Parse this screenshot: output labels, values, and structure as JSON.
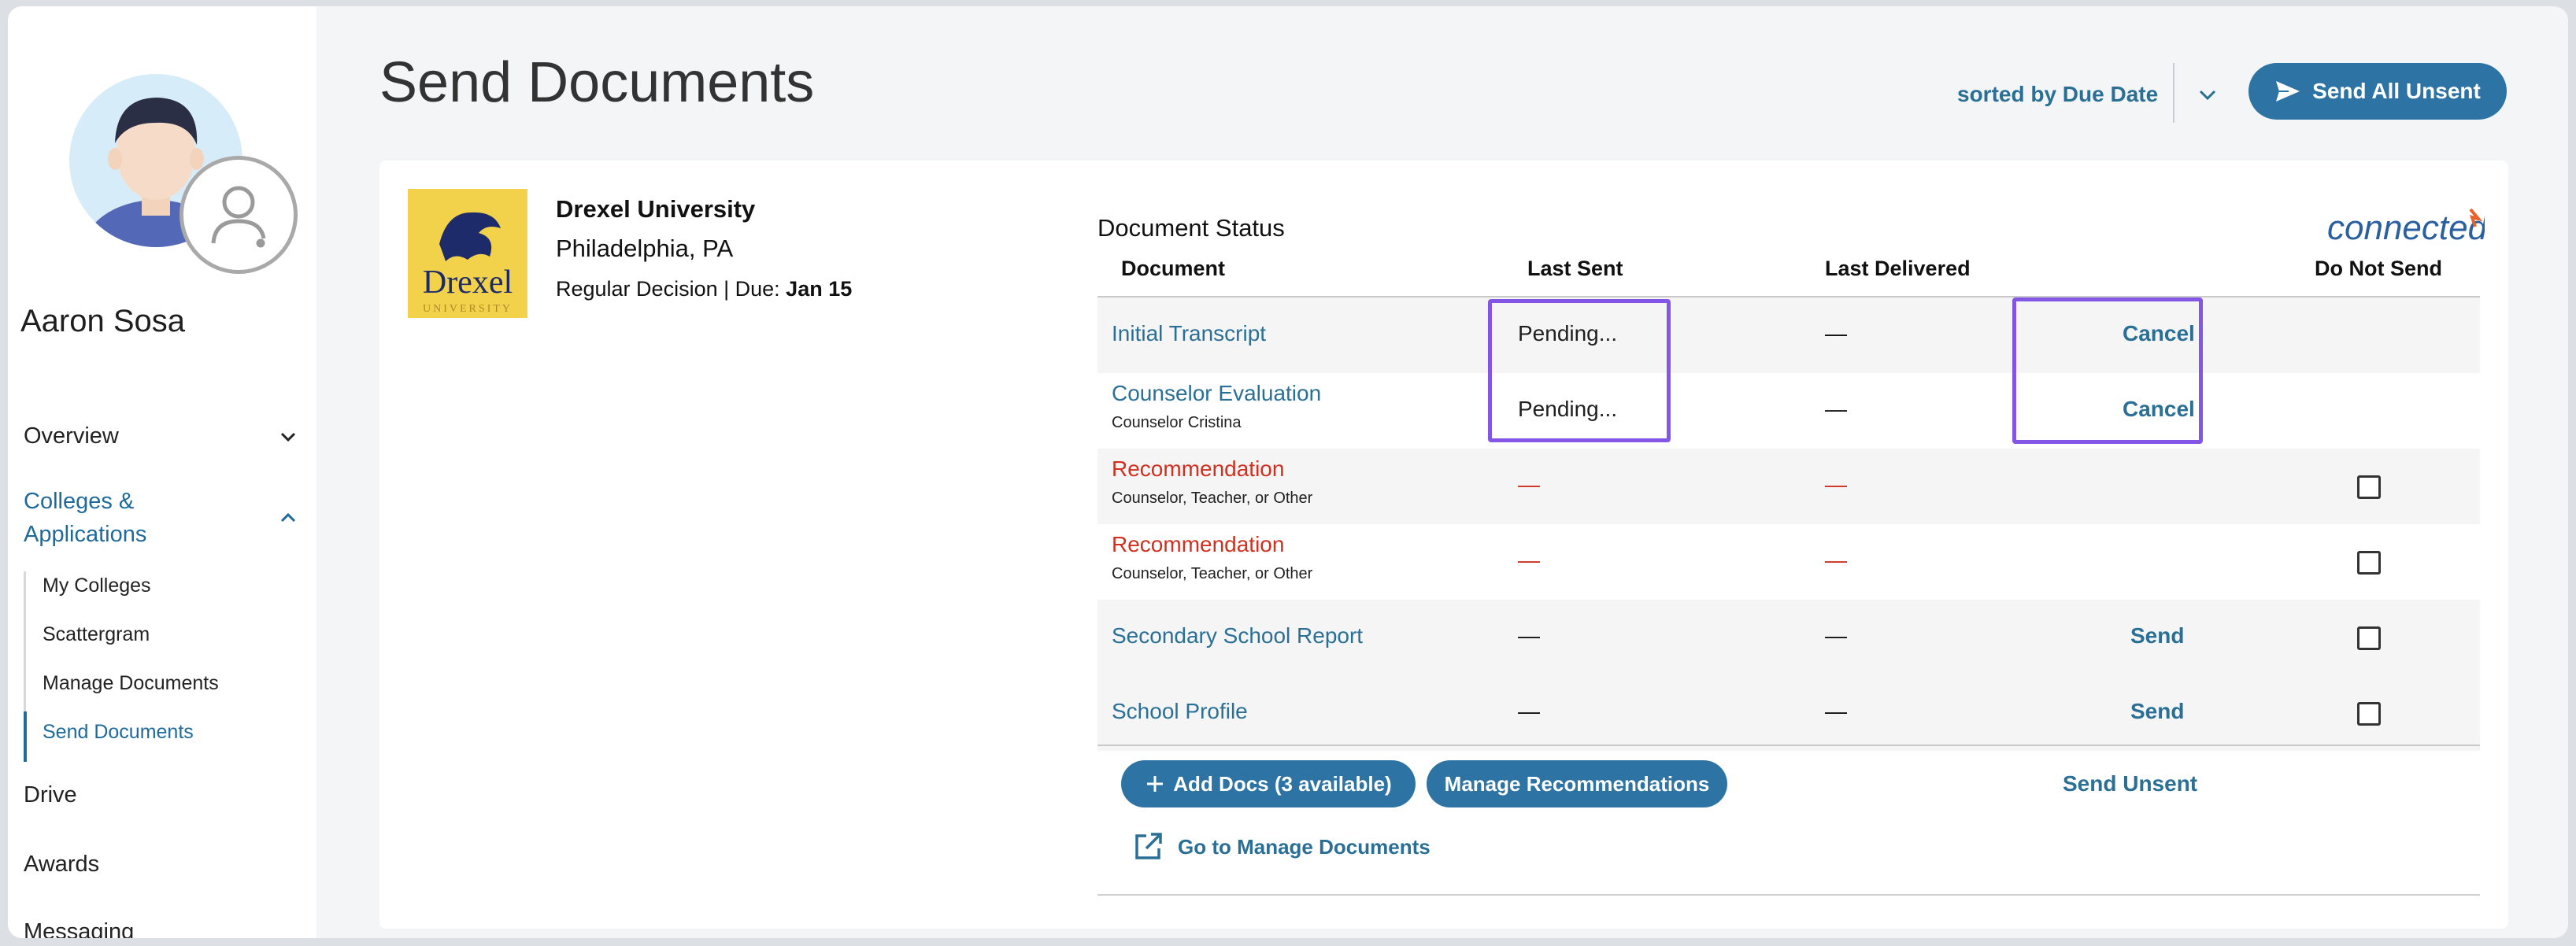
{
  "page": {
    "title": "Send Documents"
  },
  "user": {
    "name": "Aaron Sosa"
  },
  "sidebar": {
    "items": [
      {
        "label": "Overview",
        "expanded": false
      },
      {
        "label": "Colleges & Applications",
        "expanded": true
      },
      {
        "label": "Drive"
      },
      {
        "label": "Awards"
      },
      {
        "label": "Messaging"
      }
    ],
    "sub_items": [
      "My Colleges",
      "Scattergram",
      "Manage Documents",
      "Send Documents"
    ],
    "active_sub_item": "Send Documents"
  },
  "toolbar": {
    "sort_label": "sorted by Due Date",
    "send_all_label": "Send All Unsent"
  },
  "school": {
    "name": "Drexel University",
    "location": "Philadelphia, PA",
    "deadline_prefix": "Regular Decision | Due:",
    "deadline_date": "Jan 15",
    "logo_text": "Drexel",
    "logo_subtext": "UNIVERSITY"
  },
  "documents": {
    "title": "Document Status",
    "partner_logo": "connected",
    "columns": [
      "Document",
      "Last Sent",
      "Last Delivered",
      "Do Not Send"
    ],
    "rows": [
      {
        "name": "Initial Transcript",
        "sub": "",
        "last_sent": "Pending...",
        "last_delivered": "—",
        "action": "Cancel",
        "do_not_send": null,
        "status": "pending"
      },
      {
        "name": "Counselor Evaluation",
        "sub": "Counselor Cristina",
        "last_sent": "Pending...",
        "last_delivered": "—",
        "action": "Cancel",
        "do_not_send": null,
        "status": "pending"
      },
      {
        "name": "Recommendation",
        "sub": "Counselor, Teacher, or Other",
        "last_sent": "—",
        "last_delivered": "—",
        "action": "",
        "do_not_send": false,
        "status": "missing"
      },
      {
        "name": "Recommendation",
        "sub": "Counselor, Teacher, or Other",
        "last_sent": "—",
        "last_delivered": "—",
        "action": "",
        "do_not_send": false,
        "status": "missing"
      },
      {
        "name": "Secondary School Report",
        "sub": "",
        "last_sent": "—",
        "last_delivered": "—",
        "action": "Send",
        "do_not_send": false,
        "status": "ready"
      },
      {
        "name": "School Profile",
        "sub": "",
        "last_sent": "—",
        "last_delivered": "—",
        "action": "Send",
        "do_not_send": false,
        "status": "ready"
      }
    ],
    "add_docs_label": "Add Docs (3 available)",
    "manage_recs_label": "Manage Recommendations",
    "send_unsent_label": "Send Unsent",
    "manage_docs_link": "Go to Manage Documents"
  },
  "colors": {
    "accent": "#2d74a4",
    "link": "#2a6f96",
    "alert": "#d0301f",
    "highlight": "#8456e6"
  }
}
